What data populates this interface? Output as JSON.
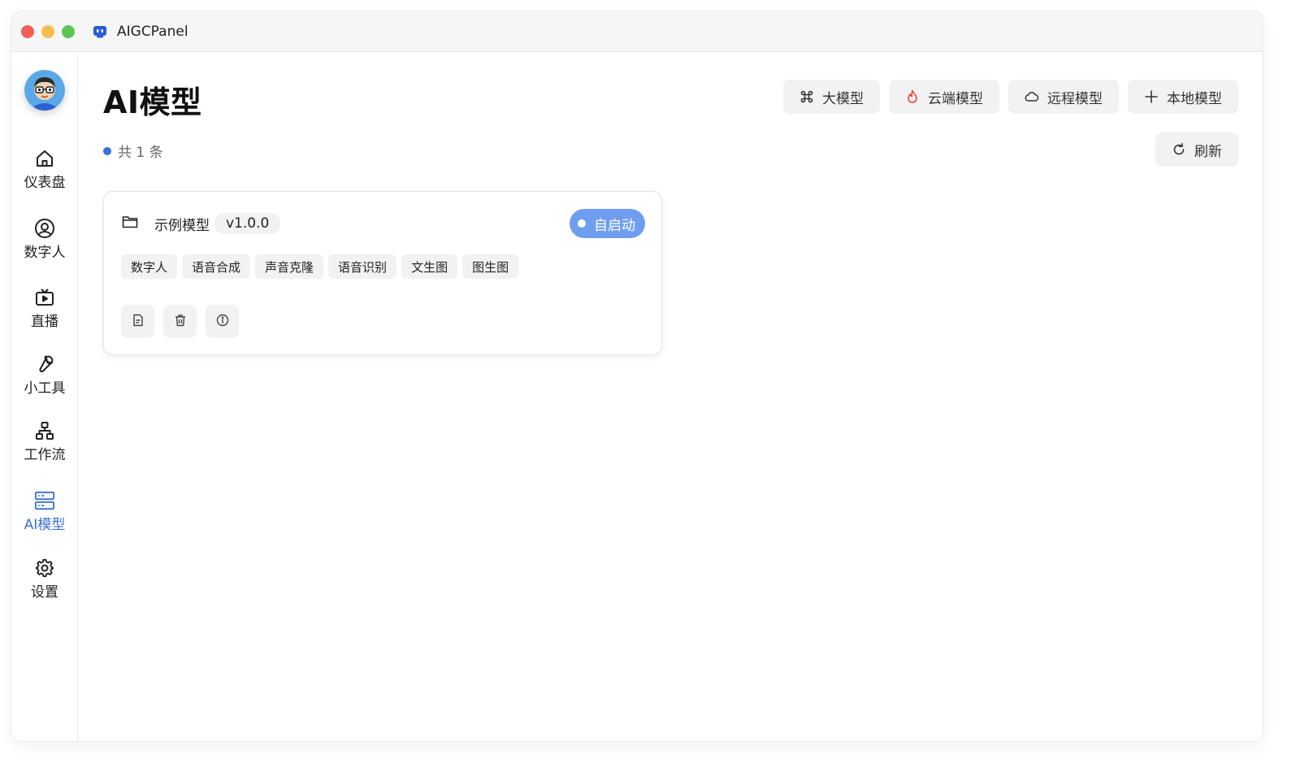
{
  "app": {
    "title": "AIGCPanel"
  },
  "sidebar": {
    "items": [
      {
        "label": "仪表盘",
        "icon": "home-icon"
      },
      {
        "label": "数字人",
        "icon": "user-circle-icon"
      },
      {
        "label": "直播",
        "icon": "tv-icon"
      },
      {
        "label": "小工具",
        "icon": "wrench-icon"
      },
      {
        "label": "工作流",
        "icon": "workflow-icon"
      },
      {
        "label": "AI模型",
        "icon": "server-icon",
        "active": true
      },
      {
        "label": "设置",
        "icon": "gear-icon"
      }
    ]
  },
  "page": {
    "title": "AI模型",
    "count_text": "共 1 条",
    "toolbar": {
      "large_model": "大模型",
      "cloud_model": "云端模型",
      "remote_model": "远程模型",
      "local_model": "本地模型"
    },
    "refresh_label": "刷新"
  },
  "model_card": {
    "name": "示例模型",
    "version": "v1.0.0",
    "autostart_label": "自启动",
    "tags": [
      "数字人",
      "语音合成",
      "声音克隆",
      "语音识别",
      "文生图",
      "图生图"
    ]
  },
  "colors": {
    "accent": "#3a6fd8",
    "autostart_bg": "#6f9ef0",
    "cloud_icon": "#e5483a"
  }
}
